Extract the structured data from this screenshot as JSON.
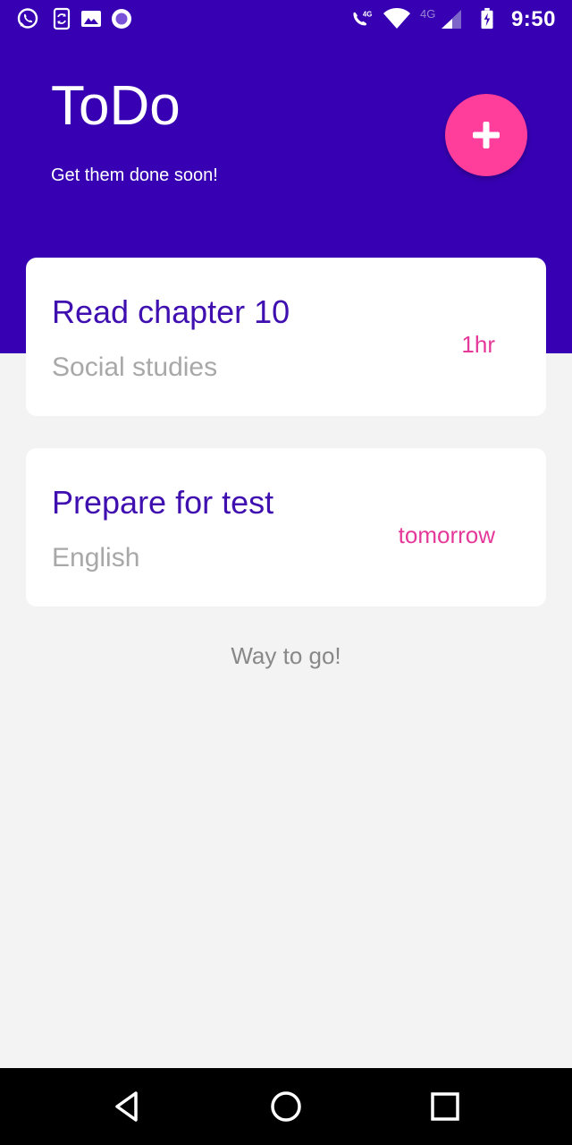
{
  "status_bar": {
    "time": "9:50",
    "left_icons": [
      "whatsapp-icon",
      "phone-sync-icon",
      "image-icon",
      "record-icon"
    ],
    "right_icons": [
      "volte-call-icon",
      "wifi-icon",
      "signal-4g-icon",
      "battery-icon"
    ],
    "network_label": "4G",
    "volte_label": "4G"
  },
  "header": {
    "title": "ToDo",
    "subtitle": "Get them done soon!",
    "add_button_icon": "plus-icon"
  },
  "tasks": [
    {
      "title": "Read chapter 10",
      "subject": "Social studies",
      "due": "1hr"
    },
    {
      "title": "Prepare for test",
      "subject": "English",
      "due": "tomorrow"
    }
  ],
  "footer_message": "Way to go!",
  "nav_bar": {
    "buttons": [
      "back-icon",
      "home-icon",
      "recents-icon"
    ]
  },
  "colors": {
    "primary": "#3700b3",
    "accent": "#ff3d9a",
    "task_title": "#3f0fb0",
    "task_due": "#e5399a",
    "background": "#f3f3f3"
  }
}
